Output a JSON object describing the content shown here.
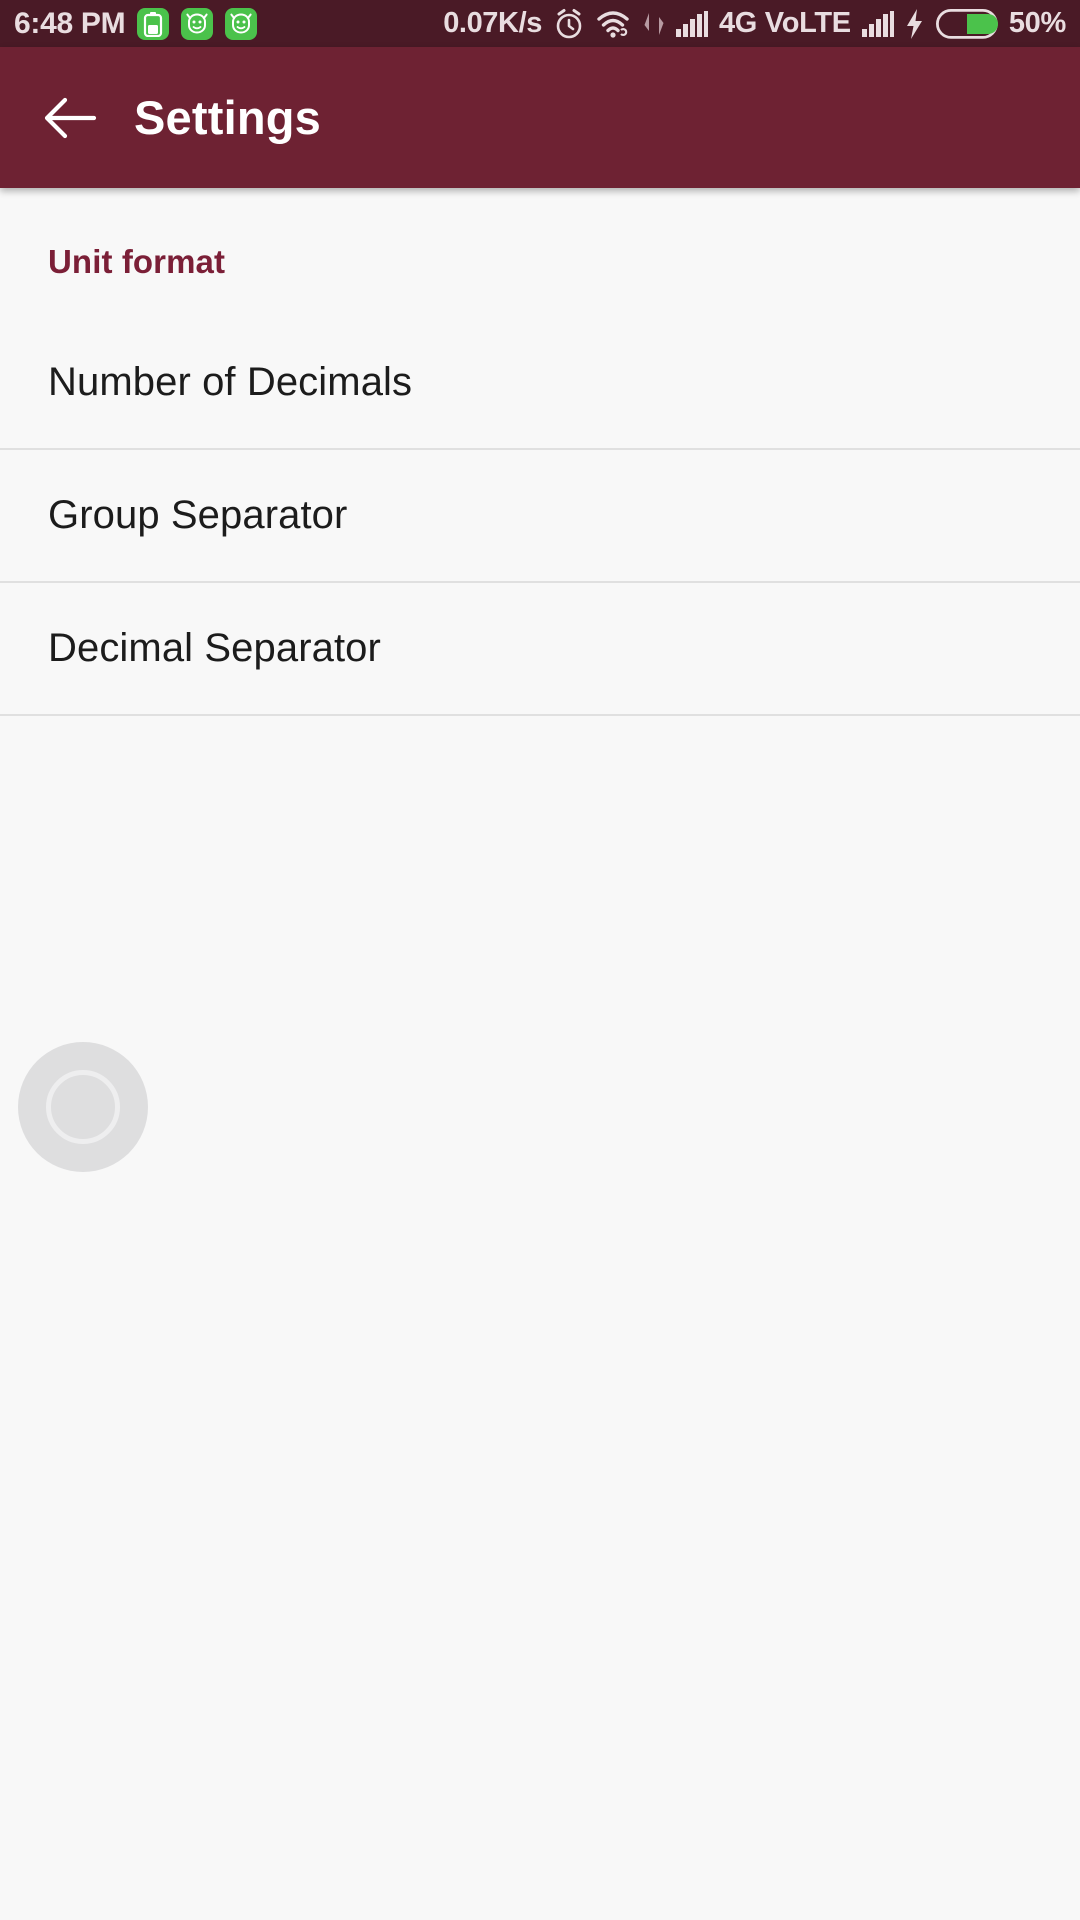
{
  "status_bar": {
    "clock": "6:48 PM",
    "network_speed": "0.07K/s",
    "carrier": "4G VoLTE",
    "battery_percent": "50%",
    "notification_icons": [
      "battery-saver-icon",
      "android-app-icon",
      "android-app-icon"
    ],
    "system_icons": [
      "alarm-icon",
      "wifi-icon",
      "data-transfer-icon",
      "signal-bars-icon",
      "signal-bars-icon",
      "charging-bolt-icon",
      "battery-icon"
    ],
    "battery_level": 50,
    "colors": {
      "background": "#4a1a26",
      "text": "#e9dde0",
      "notification_badge": "#4bc24b",
      "battery_fill": "#4bc24b"
    }
  },
  "app_bar": {
    "back_label": "Navigate up",
    "title": "Settings",
    "colors": {
      "background": "#6e2233",
      "text": "#ffffff"
    }
  },
  "content": {
    "section_header": "Unit format",
    "section_header_color": "#7b1f37",
    "background": "#f8f8f8",
    "preferences": [
      {
        "title": "Number of Decimals"
      },
      {
        "title": "Group Separator"
      },
      {
        "title": "Decimal Separator"
      }
    ]
  },
  "floating_button": {
    "name": "assistive-touch-button"
  }
}
